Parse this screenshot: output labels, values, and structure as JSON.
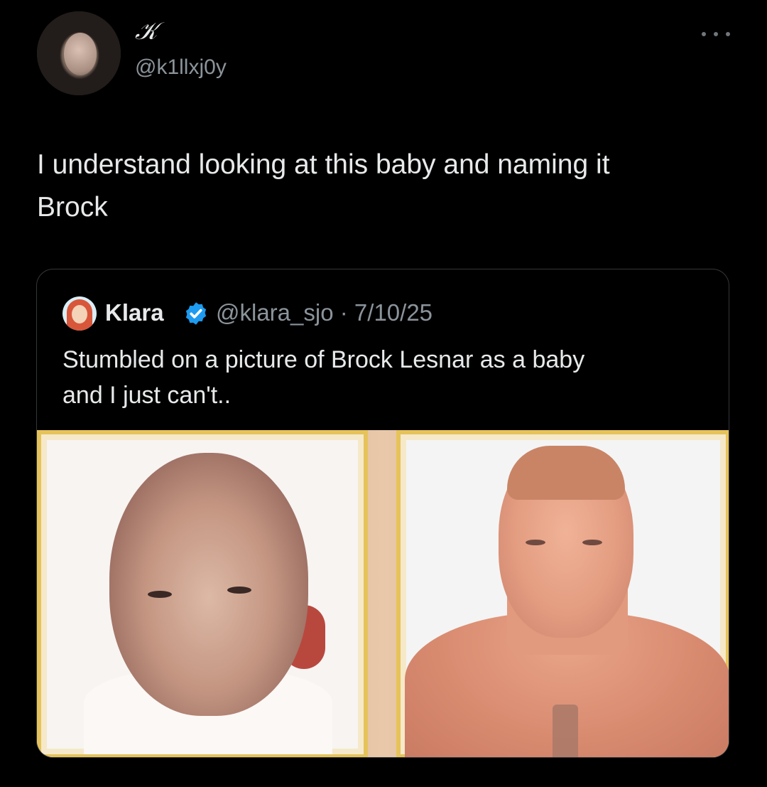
{
  "tweet": {
    "display_name": "𝒦",
    "handle": "@k1llxj0y",
    "text_line1": "I understand looking at this baby and naming it",
    "text_line2": "Brock"
  },
  "quoted_tweet": {
    "display_name": "Klara",
    "handle": "@klara_sjo",
    "separator": "·",
    "date": "7/10/25",
    "text_line1": "Stumbled on a picture of Brock Lesnar as a baby",
    "text_line2": "and I just can't.."
  },
  "icons": {
    "more": "more-icon",
    "verified": "verified-badge-icon"
  },
  "colors": {
    "background": "#000000",
    "text": "#e7e9ea",
    "secondary_text": "#8b949b",
    "verified": "#1d9bf0",
    "card_border": "#333639",
    "frame_gold": "#e6c35a"
  }
}
